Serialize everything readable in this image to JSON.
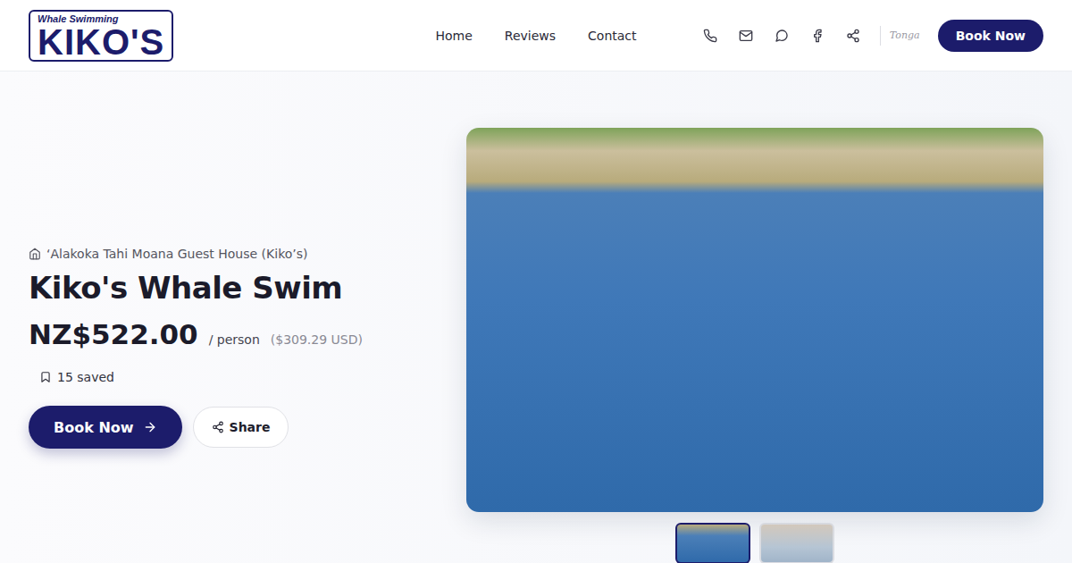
{
  "header": {
    "logo": {
      "top": "Whale Swimming",
      "main": "KIKO'S"
    },
    "nav": [
      {
        "label": "Home"
      },
      {
        "label": "Reviews"
      },
      {
        "label": "Contact"
      }
    ],
    "partner_logo": "Tonga",
    "book_button": "Book Now"
  },
  "listing": {
    "location": "‘Alakoka Tahi Moana Guest House (Kiko’s)",
    "title": "Kiko's Whale Swim",
    "price": "NZ$522.00",
    "unit": "/ person",
    "alt_price": "($309.29 USD)",
    "saved": "15 saved",
    "book_button": "Book Now",
    "share_button": "Share"
  },
  "gallery": {
    "thumbnails": [
      {
        "selected": true
      },
      {
        "selected": false
      }
    ]
  }
}
